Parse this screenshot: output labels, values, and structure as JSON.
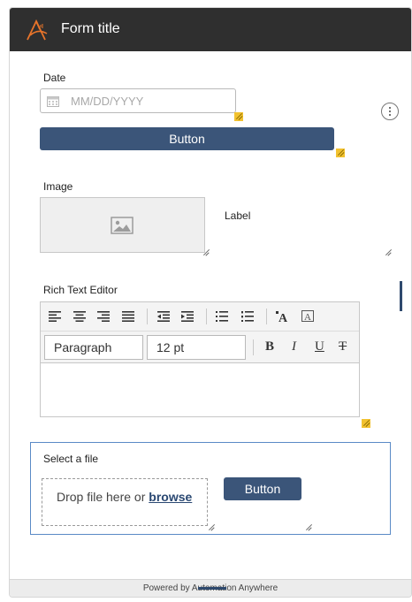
{
  "form": {
    "title": "Form title"
  },
  "date": {
    "label": "Date",
    "placeholder": "MM/DD/YYYY"
  },
  "primary_button": {
    "label": "Button"
  },
  "image": {
    "label": "Image",
    "side_label": "Label"
  },
  "rich_text": {
    "label": "Rich Text Editor",
    "paragraph_style": "Paragraph",
    "font_size": "12 pt",
    "bold": "B",
    "italic": "I",
    "underline": "U",
    "strikethrough": "T"
  },
  "file": {
    "label": "Select a file",
    "drop_text": "Drop file here or",
    "browse_link": "browse",
    "button_label": "Button"
  },
  "footer": {
    "text": "Powered by Automation Anywhere"
  },
  "colors": {
    "title_bar": "#2f2f2f",
    "button": "#3b5579",
    "accent_handle": "#f2c230",
    "file_border": "#5a8ac6"
  },
  "icons": {
    "logo": "automation-anywhere-logo-icon",
    "calendar": "calendar-icon",
    "more": "more-options-icon",
    "image_placeholder": "image-placeholder-icon"
  }
}
